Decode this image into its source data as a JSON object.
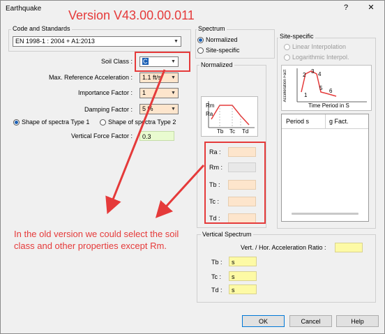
{
  "window": {
    "title": "Earthquake",
    "help_btn": "?",
    "close_btn": "✕"
  },
  "annotation": {
    "version": "Version V43.00.00.011",
    "note": "In the old version we could select the soil class and other properties except Rm."
  },
  "code_standards": {
    "group_label": "Code and Standards",
    "selected": "EN 1998-1 : 2004 + A1:2013"
  },
  "params": {
    "soil_class_label": "Soil Class :",
    "soil_class_value": "C",
    "max_accel_label": "Max. Reference Acceleration :",
    "max_accel_value": "1.1 ft/s",
    "importance_label": "Importance Factor :",
    "importance_value": "1",
    "damping_label": "Damping Factor :",
    "damping_value": "5 %",
    "shape1_label": "Shape of spectra Type 1",
    "shape2_label": "Shape of spectra Type 2",
    "vertical_force_label": "Vertical Force Factor :",
    "vertical_force_value": "0.3"
  },
  "spectrum": {
    "group_label": "Spectrum",
    "normalized_label": "Normalized",
    "site_specific_label": "Site-specific"
  },
  "normalized": {
    "group_label": "Normalized",
    "chart_labels": {
      "rm": "Rm",
      "ra": "Ra",
      "tb": "Tb",
      "tc": "Tc",
      "td": "Td"
    },
    "ra_label": "Ra :",
    "rm_label": "Rm :",
    "tb_label": "Tb :",
    "tc_label": "Tc :",
    "td_label": "Td :",
    "ra_value": "",
    "rm_value": "",
    "tb_value": "",
    "tc_value": "",
    "td_value": ""
  },
  "site_specific": {
    "group_label": "Site-specific",
    "linear_label": "Linear Interpolation",
    "log_label": "Logarithmic Interpol.",
    "chart_ylabel": "Acceleration Fact",
    "chart_xlabel": "Time Period in S",
    "chart_points": [
      "1",
      "2",
      "3",
      "4",
      "5",
      "6"
    ],
    "col_period": "Period s",
    "col_gfact": "g Fact."
  },
  "vertical_spectrum": {
    "group_label": "Vertical Spectrum",
    "ratio_label": "Vert. / Hor. Acceleration Ratio :",
    "ratio_value": "",
    "tb_label": "Tb :",
    "tc_label": "Tc :",
    "td_label": "Td :",
    "tb_value": "s",
    "tc_value": "s",
    "td_value": "s"
  },
  "buttons": {
    "ok": "OK",
    "cancel": "Cancel",
    "help": "Help"
  },
  "colors": {
    "annotation_red": "#e53a3a",
    "input_peach": "#fde5cc",
    "input_yellow": "#fdfaa5",
    "input_green": "#e9fbd0",
    "accent_blue": "#1a5fb4"
  }
}
